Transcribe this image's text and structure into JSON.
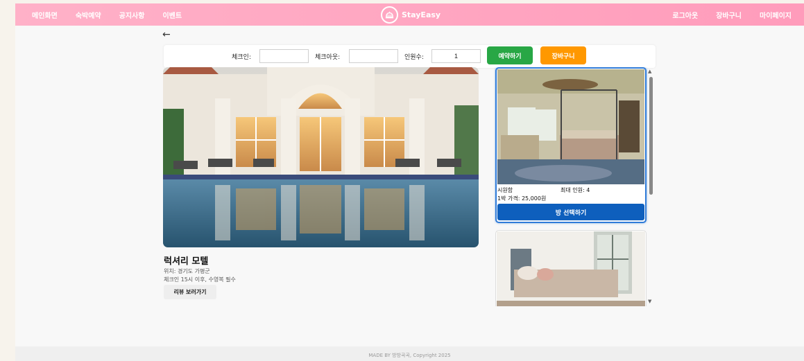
{
  "nav": {
    "left_items": [
      "메인화면",
      "숙박예약",
      "공지사항",
      "이벤트"
    ],
    "brand": "StayEasy",
    "right_items": [
      "로그아웃",
      "장바구니",
      "마이페이지"
    ]
  },
  "back_icon": "arrow-left-icon",
  "search": {
    "checkin_label": "체크인:",
    "checkin_value": "",
    "checkout_label": "체크아웃:",
    "checkout_value": "",
    "guests_label": "인원수:",
    "guests_value": "1",
    "reserve_button": "예약하기",
    "cart_button": "장바구니"
  },
  "colors": {
    "navbar": "#ff9cbb",
    "reserve": "#28a745",
    "cart": "#ff9800",
    "select_room": "#0e5fbd",
    "selected_border": "#2f7bd8"
  },
  "hotel": {
    "name": "럭셔리 모텔",
    "location": "위치: 경기도 가평군",
    "note": "체크인 15시 이후, 수영복 필수",
    "review_button": "리뷰 보러가기"
  },
  "rooms": [
    {
      "name": "시원함",
      "capacity": "최대 인원: 4",
      "price": "1박 가격: 25,000원",
      "select_button": "방 선택하기"
    }
  ],
  "footer": "MADE BY 방방곡곡, Copyright 2025"
}
